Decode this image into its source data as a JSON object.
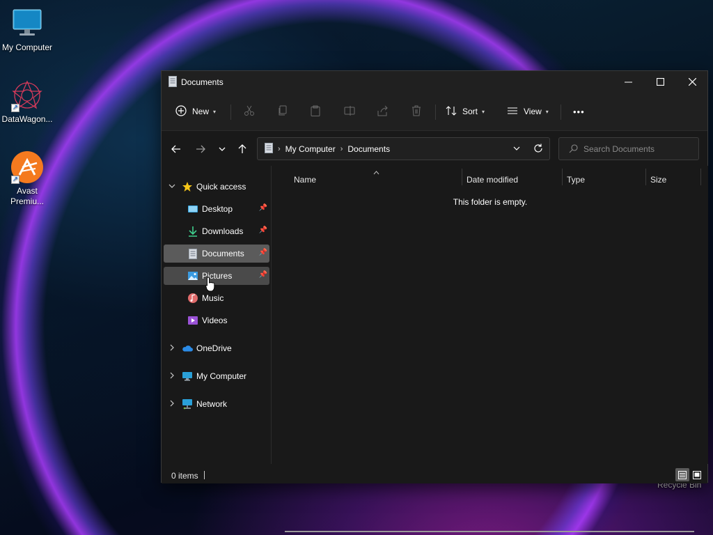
{
  "desktop": {
    "icons": [
      {
        "label": "My Computer",
        "icon": "monitor-icon"
      },
      {
        "label": "DataWagon...",
        "icon": "datawagon-icon"
      },
      {
        "label": "Avast Premiu...",
        "icon": "avast-icon"
      }
    ],
    "recycle_bin_label": "Recycle Bin"
  },
  "window": {
    "title": "Documents",
    "controls": {
      "minimize": "—",
      "maximize": "☐",
      "close": "✕"
    }
  },
  "commandbar": {
    "new_label": "New",
    "sort_label": "Sort",
    "view_label": "View",
    "more_label": "•••"
  },
  "address": {
    "crumbs": [
      "My Computer",
      "Documents"
    ],
    "search_placeholder": "Search Documents"
  },
  "nav": {
    "quick_access": "Quick access",
    "items": [
      {
        "label": "Desktop",
        "icon": "desktop-folder-icon",
        "pinned": true
      },
      {
        "label": "Downloads",
        "icon": "downloads-icon",
        "pinned": true
      },
      {
        "label": "Documents",
        "icon": "documents-icon",
        "pinned": true,
        "selected": true
      },
      {
        "label": "Pictures",
        "icon": "pictures-icon",
        "pinned": true,
        "hover": true
      },
      {
        "label": "Music",
        "icon": "music-icon",
        "pinned": false
      },
      {
        "label": "Videos",
        "icon": "videos-icon",
        "pinned": false
      }
    ],
    "onedrive": "OneDrive",
    "my_computer": "My Computer",
    "network": "Network"
  },
  "filepane": {
    "columns": [
      "Name",
      "Date modified",
      "Type",
      "Size"
    ],
    "empty_message": "This folder is empty."
  },
  "status": {
    "count": "0 items"
  },
  "colors": {
    "window_bg": "#191919",
    "chrome_bg": "#202020",
    "selected": "#5b5b5b",
    "accent_folder": "#f5c518"
  }
}
